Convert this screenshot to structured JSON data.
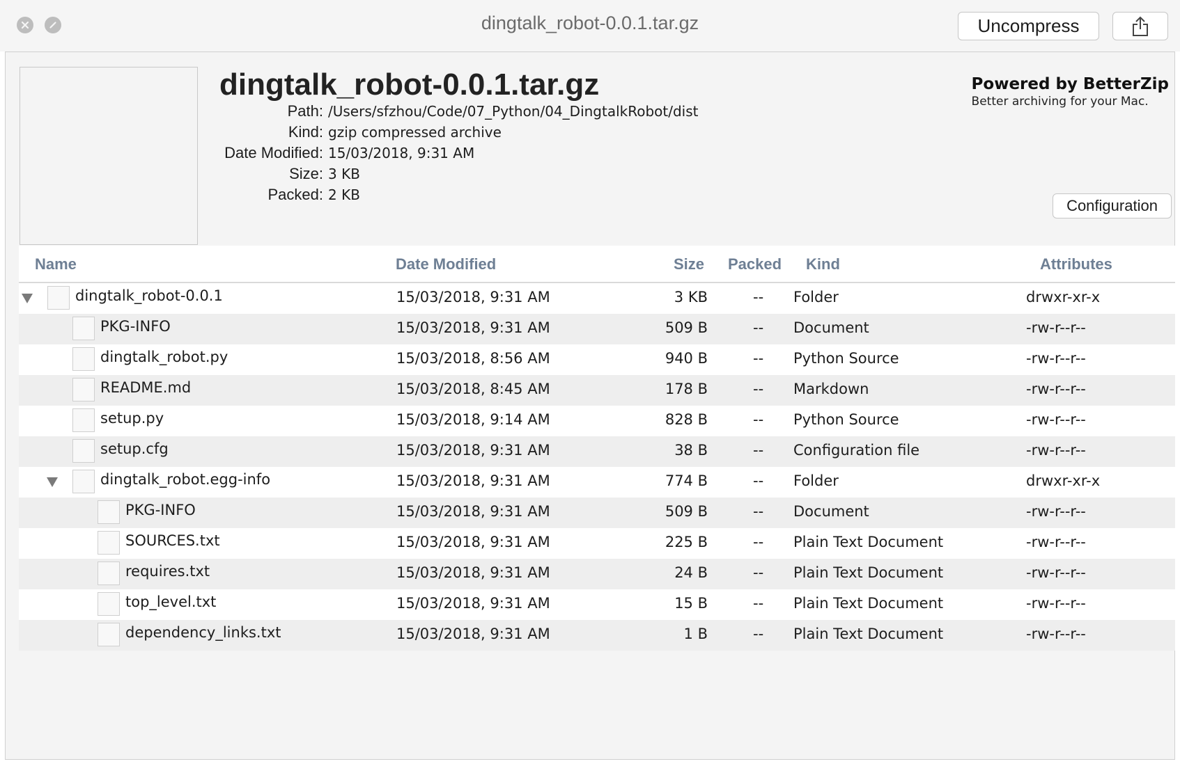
{
  "window": {
    "title": "dingtalk_robot-0.0.1.tar.gz",
    "uncompress_label": "Uncompress",
    "share_icon": "share-icon",
    "close_icon": "close-icon",
    "minimize_icon": "minimize-icon"
  },
  "header": {
    "file_title": "dingtalk_robot-0.0.1.tar.gz",
    "info": [
      {
        "label": "Path:",
        "value": "/Users/sfzhou/Code/07_Python/04_DingtalkRobot/dist"
      },
      {
        "label": "Kind:",
        "value": "gzip compressed archive"
      },
      {
        "label": "Date Modified:",
        "value": "15/03/2018, 9:31 AM"
      },
      {
        "label": "Size:",
        "value": "3 KB"
      },
      {
        "label": "Packed:",
        "value": "2 KB"
      }
    ],
    "powered_title": "Powered by BetterZip",
    "powered_subtitle": "Better archiving for your Mac.",
    "configuration_label": "Configuration"
  },
  "table": {
    "columns": {
      "name": "Name",
      "date": "Date Modified",
      "size": "Size",
      "packed": "Packed",
      "kind": "Kind",
      "attributes": "Attributes"
    },
    "rows": [
      {
        "name": "dingtalk_robot-0.0.1",
        "depth": 0,
        "expanded": true,
        "date": "15/03/2018, 9:31 AM",
        "size": "3 KB",
        "packed": "--",
        "kind": "Folder",
        "attributes": "drwxr-xr-x"
      },
      {
        "name": "PKG-INFO",
        "depth": 1,
        "date": "15/03/2018, 9:31 AM",
        "size": "509 B",
        "packed": "--",
        "kind": "Document",
        "attributes": "-rw-r--r--"
      },
      {
        "name": "dingtalk_robot.py",
        "depth": 1,
        "date": "15/03/2018, 8:56 AM",
        "size": "940 B",
        "packed": "--",
        "kind": "Python Source",
        "attributes": "-rw-r--r--"
      },
      {
        "name": "README.md",
        "depth": 1,
        "date": "15/03/2018, 8:45 AM",
        "size": "178 B",
        "packed": "--",
        "kind": "Markdown",
        "attributes": "-rw-r--r--"
      },
      {
        "name": "setup.py",
        "depth": 1,
        "date": "15/03/2018, 9:14 AM",
        "size": "828 B",
        "packed": "--",
        "kind": "Python Source",
        "attributes": "-rw-r--r--"
      },
      {
        "name": "setup.cfg",
        "depth": 1,
        "date": "15/03/2018, 9:31 AM",
        "size": "38 B",
        "packed": "--",
        "kind": "Configuration file",
        "attributes": "-rw-r--r--"
      },
      {
        "name": "dingtalk_robot.egg-info",
        "depth": 1,
        "expanded": true,
        "date": "15/03/2018, 9:31 AM",
        "size": "774 B",
        "packed": "--",
        "kind": "Folder",
        "attributes": "drwxr-xr-x"
      },
      {
        "name": "PKG-INFO",
        "depth": 2,
        "date": "15/03/2018, 9:31 AM",
        "size": "509 B",
        "packed": "--",
        "kind": "Document",
        "attributes": "-rw-r--r--"
      },
      {
        "name": "SOURCES.txt",
        "depth": 2,
        "date": "15/03/2018, 9:31 AM",
        "size": "225 B",
        "packed": "--",
        "kind": "Plain Text Document",
        "attributes": "-rw-r--r--"
      },
      {
        "name": "requires.txt",
        "depth": 2,
        "date": "15/03/2018, 9:31 AM",
        "size": "24 B",
        "packed": "--",
        "kind": "Plain Text Document",
        "attributes": "-rw-r--r--"
      },
      {
        "name": "top_level.txt",
        "depth": 2,
        "date": "15/03/2018, 9:31 AM",
        "size": "15 B",
        "packed": "--",
        "kind": "Plain Text Document",
        "attributes": "-rw-r--r--"
      },
      {
        "name": "dependency_links.txt",
        "depth": 2,
        "date": "15/03/2018, 9:31 AM",
        "size": "1 B",
        "packed": "--",
        "kind": "Plain Text Document",
        "attributes": "-rw-r--r--"
      }
    ]
  }
}
